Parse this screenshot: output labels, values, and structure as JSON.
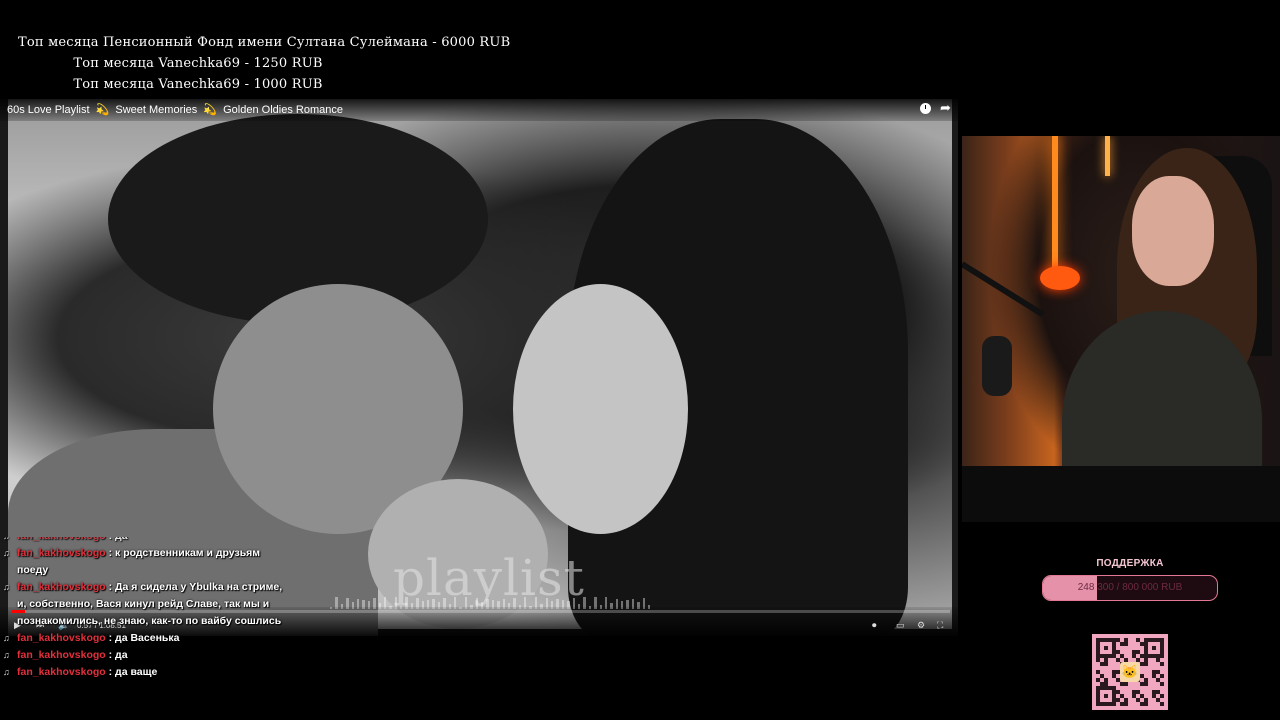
{
  "top_donors": [
    "Топ месяца Пенсионный Фонд имени Султана Сулеймана - 6000 RUB",
    "Топ месяца Vanechka69 - 1250 RUB",
    "Топ месяца Vanechka69 - 1000 RUB"
  ],
  "video": {
    "title_parts": [
      "60s Love Playlist",
      "Sweet Memories",
      "Golden Oldies Romance"
    ],
    "title_separator": "💫",
    "overlay_word": "playlist",
    "time": "0:57 / 1:08:51",
    "progress_fraction": 0.014,
    "icons": [
      "clock-icon",
      "share-icon",
      "play-icon",
      "next-icon",
      "volume-icon",
      "autoplay-toggle-icon",
      "subtitles-icon",
      "settings-icon",
      "fullscreen-icon"
    ]
  },
  "donation_goal": {
    "title": "ПОДДЕРЖКА",
    "text": "248 300 / 800 000 RUB",
    "fraction": 0.31
  },
  "chat": {
    "messages": [
      {
        "user": "fan_kakhovskogo",
        "text": "да"
      },
      {
        "user": "fan_kakhovskogo",
        "text": "к родственникам и друзьям поеду"
      },
      {
        "user": "fan_kakhovskogo",
        "text": "Да я сидела у Ybulka на стриме, и, собственно, Вася кинул рейд Славе, так мы и познакомились, не знаю, как-то по вайбу сошлись"
      },
      {
        "user": "fan_kakhovskogo",
        "text": "да Васенька"
      },
      {
        "user": "fan_kakhovskogo",
        "text": "да"
      },
      {
        "user": "fan_kakhovskogo",
        "text": "да ваще"
      }
    ]
  },
  "colors": {
    "chat_username": "#e3303b",
    "goal_fill": "#e591aa",
    "progress": "#ff0000",
    "qr_background": "#f2a7c1"
  }
}
